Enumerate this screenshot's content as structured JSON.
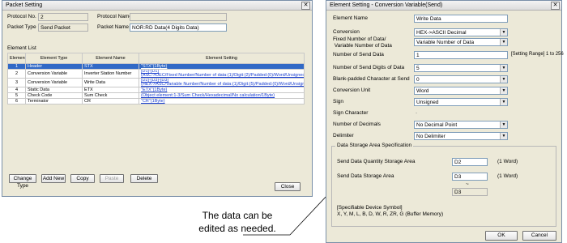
{
  "left_window": {
    "title": "Packet Setting",
    "protocol_no_label": "Protocol No.",
    "protocol_no_value": "2",
    "protocol_name_label": "Protocol Name",
    "protocol_name_value": "",
    "packet_type_label": "Packet Type",
    "packet_type_value": "Send Packet",
    "packet_name_label": "Packet Name",
    "packet_name_value": "NOR:RD Data(4 Digits Data)",
    "element_list_label": "Element List",
    "columns": [
      "Element No.",
      "Element Type",
      "Element Name",
      "Element Setting"
    ],
    "rows": [
      {
        "no": "1",
        "type": "Header",
        "name": "STX",
        "setting": "\"STX\"(1Byte)"
      },
      {
        "no": "2",
        "type": "Conversion Variable",
        "name": "Inverter Station Number",
        "setting": "[D1]-[D1]\n(ASC->DEC/Fixed Number/Number of data:(1)/Digit:(2)/Padded:(0)/Word/Unsigned/Decimal point:(none)/Delimiter:(none))"
      },
      {
        "no": "3",
        "type": "Conversion Variable",
        "name": "Write Data",
        "setting": "[D2]-[D3]-[D3]\n(HEX->ASC/Variable Number/Number of data:(1)/Digit:(5)/Padded:(0)/Word/Unsigned/Decimal point:(none)/Delimiter:(none))"
      },
      {
        "no": "4",
        "type": "Static Data",
        "name": "ETX",
        "setting": "\"ETX\"(1Byte)"
      },
      {
        "no": "5",
        "type": "Check Code",
        "name": "Sum Check",
        "setting": "(Object element:1-3/Sum Check/Hexadecimal/No calculation/1Byte)"
      },
      {
        "no": "6",
        "type": "Terminator",
        "name": "CR",
        "setting": "\"CR\"(1Byte)"
      }
    ],
    "buttons": {
      "change_type": "Change Type",
      "add_new": "Add New",
      "copy": "Copy",
      "paste": "Paste",
      "delete": "Delete",
      "close": "Close"
    }
  },
  "right_window": {
    "title": "Element Setting - Conversion Variable(Send)",
    "fields": {
      "element_name": {
        "label": "Element Name",
        "value": "Write Data"
      },
      "conversion": {
        "label": "Conversion",
        "value": "HEX->ASCII Decimal"
      },
      "fixed_variable": {
        "label": "Fixed Number of Data/\n Variable Number of Data",
        "value": "Variable Number of Data"
      },
      "send_data_count": {
        "label": "Number of Send Data",
        "value": "1",
        "hint": "[Setting Range] 1 to 256"
      },
      "send_digits": {
        "label": "Number of Send Digits of Data",
        "value": "5"
      },
      "blank_padded": {
        "label": "Blank-padded Character at Send",
        "value": "0"
      },
      "conversion_unit": {
        "label": "Conversion Unit",
        "value": "Word"
      },
      "sign": {
        "label": "Sign",
        "value": "Unsigned"
      },
      "sign_character": {
        "label": "Sign Character",
        "value": "-"
      },
      "decimals": {
        "label": "Number of Decimals",
        "value": "No Decimal Point"
      },
      "delimiter": {
        "label": "Delimiter",
        "value": "No Delimiter"
      }
    },
    "storage": {
      "group_label": "Data Storage Area Specification",
      "qty_label": "Send Data Quantity Storage Area",
      "qty_value": "D2",
      "qty_unit": "(1 Word)",
      "area_label": "Send Data Storage Area",
      "area_value1": "D3",
      "area_unit": "(1 Word)",
      "area_value2": "D3",
      "tilde": "~",
      "device_title": "[Specifiable Device Symbol]",
      "device_list": "X, Y, M, L, B, D, W, R, ZR, G (Buffer Memory)"
    },
    "buttons": {
      "ok": "OK",
      "cancel": "Cancel"
    }
  },
  "callout": {
    "line1": "The data can be",
    "line2": "edited as needed."
  }
}
